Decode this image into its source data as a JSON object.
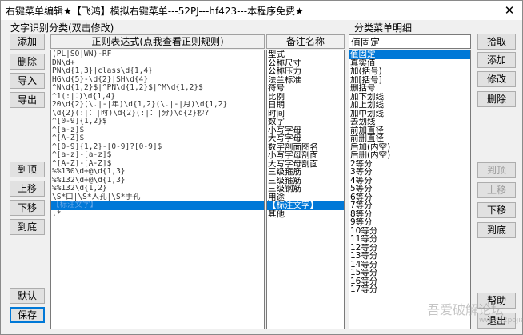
{
  "window": {
    "title": "右键菜单编辑★【飞鸿】模拟右键菜单---52PJ---hf423---本程序免费★",
    "close_glyph": "✕"
  },
  "left_section": {
    "label": "文字识别分类(双击修改)",
    "buttons": {
      "add": "添加",
      "delete": "删除",
      "import": "导入",
      "export": "导出",
      "top": "到顶",
      "up": "上移",
      "down": "下移",
      "bottom": "到底",
      "default": "默认",
      "save": "保存"
    },
    "regex_header": "正则表达式(点我查看正则规则)",
    "remark_header": "备注名称",
    "regex_items": [
      "(PL|SO|WN)-RF",
      "DN\\d+",
      "PN\\d{1,3}|class\\d{1,4}",
      "HG\\d{5}-\\d{2}|SH\\d{4}",
      "^N\\d{1,2}$|^PN\\d{1,2}$|^M\\d{1,2}$",
      "^1(:|：)\\d{1,4}",
      "20\\d{2}(\\.|-|年)\\d{1,2}(\\.|-|月)\\d{1,2}",
      "\\d{2}(:|：|时)\\d{2}(:|：|分)\\d{2}秒?",
      "^[0-9]{1,2}$",
      "^[a-z]$",
      "^[A-Z]$",
      "^[0-9]{1,2}-[0-9]?[0-9]$",
      "^[a-z]-[a-z]$",
      "^[A-Z]-[A-Z]$",
      "%%130\\d+@\\d{1,3}",
      "%%132\\d+@\\d{1,3}",
      "%%132\\d{1,2}",
      "\\S*口|\\S*人孔|\\S*手孔",
      "【标注文字】",
      ".*"
    ],
    "remark_items": [
      "型式",
      "公称尺寸",
      "公称压力",
      "法兰标准",
      "符号",
      "比例",
      "日期",
      "时间",
      "数字",
      "小写字母",
      "大写字母",
      "数字剖面图名",
      "小写字母剖面",
      "大写字母剖面",
      "三级箍筋",
      "三级箍筋",
      "三级钢筋",
      "用途",
      "【标注文字】",
      "其他"
    ]
  },
  "right_section": {
    "label": "分类菜单明细",
    "input_value": "值固定",
    "buttons": {
      "pick": "拾取",
      "add": "添加",
      "modify": "修改",
      "delete": "删除",
      "top": "到顶",
      "up": "上移",
      "down": "下移",
      "bottom": "到底",
      "help": "帮助",
      "exit": "退出"
    },
    "menu_items": [
      "值固定",
      "真实值",
      "加(括号)",
      "加[括号]",
      "删括号",
      "加下划线",
      "加上划线",
      "加中划线",
      "去划线",
      "前加直径",
      "前删直径",
      "后加(内空)",
      "后删(内空)",
      "2等分",
      "3等分",
      "4等分",
      "5等分",
      "6等分",
      "7等分",
      "8等分",
      "9等分",
      "10等分",
      "11等分",
      "12等分",
      "13等分",
      "14等分",
      "15等分",
      "16等分",
      "17等分"
    ]
  },
  "watermark": {
    "text": "吾爱破解论坛",
    "url": "www.52pojie.cn"
  },
  "colors": {
    "selection": "#0078d7",
    "window_bg": "#f0f0f0",
    "button_bg": "#e1e1e1"
  }
}
